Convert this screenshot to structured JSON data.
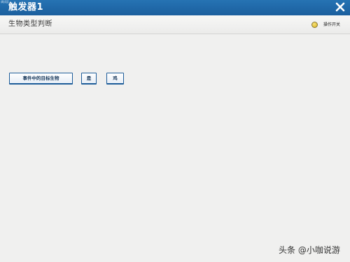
{
  "window": {
    "tiny_label": "调试区",
    "title": "触发器1",
    "close_icon": "close-icon"
  },
  "section": {
    "title": "生物类型判断",
    "toggle_label": "操作开关",
    "toggle_color": "#e8c63a"
  },
  "blocks": [
    {
      "label": "事件中的目标生物"
    },
    {
      "label": "是"
    },
    {
      "label": "鸡"
    }
  ],
  "watermark": "头条 @小咖说游",
  "colors": {
    "titlebar": "#1f67a6",
    "background": "#f0f0ef",
    "block_border": "#1d5c99"
  }
}
